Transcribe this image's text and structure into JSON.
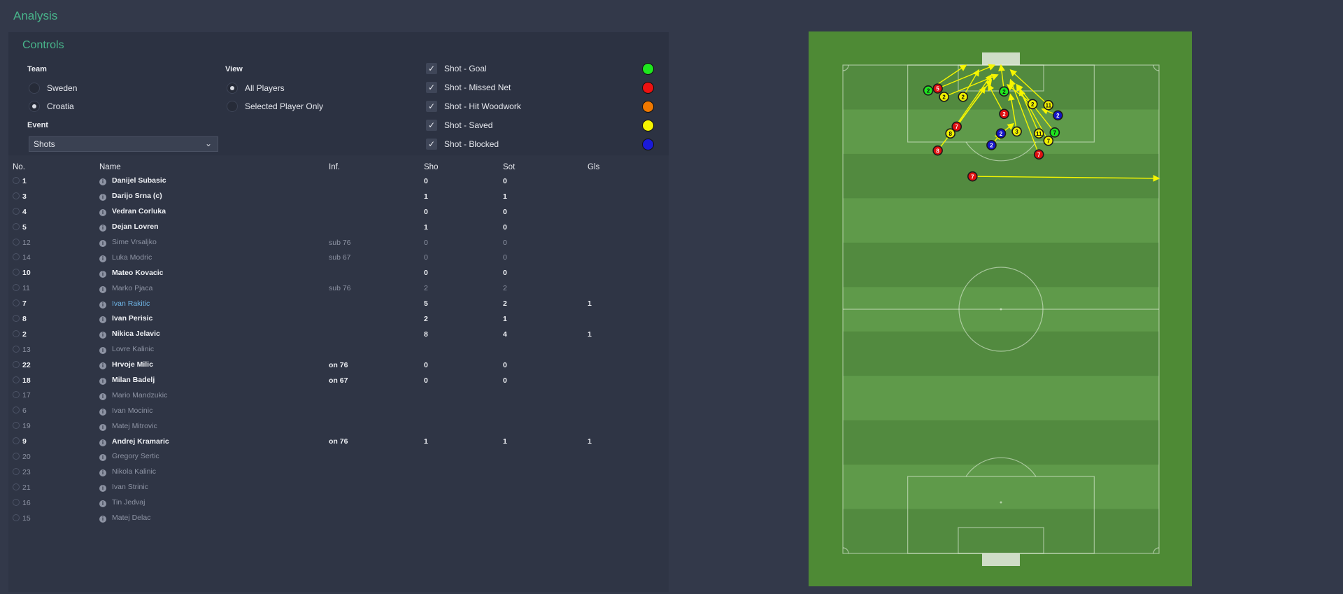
{
  "header": {
    "title": "Analysis"
  },
  "controls": {
    "title": "Controls",
    "team": {
      "label": "Team",
      "options": [
        "Sweden",
        "Croatia"
      ],
      "selected": "Croatia"
    },
    "view": {
      "label": "View",
      "options": [
        "All Players",
        "Selected Player Only"
      ],
      "selected": "All Players"
    },
    "event": {
      "label": "Event",
      "selected": "Shots"
    },
    "legend": [
      {
        "label": "Shot - Goal",
        "color": "#1ee61e",
        "checked": true
      },
      {
        "label": "Shot - Missed Net",
        "color": "#ee1111",
        "checked": true
      },
      {
        "label": "Shot - Hit Woodwork",
        "color": "#f07800",
        "checked": true
      },
      {
        "label": "Shot - Saved",
        "color": "#f5f500",
        "checked": true
      },
      {
        "label": "Shot - Blocked",
        "color": "#1a1ad8",
        "checked": true
      }
    ]
  },
  "table": {
    "columns": [
      "No.",
      "Name",
      "Inf.",
      "Sho",
      "Sot",
      "Gls"
    ],
    "rows": [
      {
        "no": "1",
        "name": "Danijel Subasic",
        "inf": "",
        "sho": "0",
        "sot": "0",
        "gls": "",
        "dim": false
      },
      {
        "no": "3",
        "name": "Darijo Srna (c)",
        "inf": "",
        "sho": "1",
        "sot": "1",
        "gls": "",
        "dim": false
      },
      {
        "no": "4",
        "name": "Vedran Corluka",
        "inf": "",
        "sho": "0",
        "sot": "0",
        "gls": "",
        "dim": false
      },
      {
        "no": "5",
        "name": "Dejan Lovren",
        "inf": "",
        "sho": "1",
        "sot": "0",
        "gls": "",
        "dim": false
      },
      {
        "no": "12",
        "name": "Sime Vrsaljko",
        "inf": "sub 76",
        "sho": "0",
        "sot": "0",
        "gls": "",
        "dim": true
      },
      {
        "no": "14",
        "name": "Luka Modric",
        "inf": "sub 67",
        "sho": "0",
        "sot": "0",
        "gls": "",
        "dim": true
      },
      {
        "no": "10",
        "name": "Mateo Kovacic",
        "inf": "",
        "sho": "0",
        "sot": "0",
        "gls": "",
        "dim": false
      },
      {
        "no": "11",
        "name": "Marko Pjaca",
        "inf": "sub 76",
        "sho": "2",
        "sot": "2",
        "gls": "",
        "dim": true
      },
      {
        "no": "7",
        "name": "Ivan Rakitic",
        "inf": "",
        "sho": "5",
        "sot": "2",
        "gls": "1",
        "dim": false,
        "selected": true
      },
      {
        "no": "8",
        "name": "Ivan Perisic",
        "inf": "",
        "sho": "2",
        "sot": "1",
        "gls": "",
        "dim": false
      },
      {
        "no": "2",
        "name": "Nikica Jelavic",
        "inf": "",
        "sho": "8",
        "sot": "4",
        "gls": "1",
        "dim": false
      },
      {
        "no": "13",
        "name": "Lovre Kalinic",
        "inf": "",
        "sho": "",
        "sot": "",
        "gls": "",
        "dim": true
      },
      {
        "no": "22",
        "name": "Hrvoje Milic",
        "inf": "on 76",
        "sho": "0",
        "sot": "0",
        "gls": "",
        "dim": false
      },
      {
        "no": "18",
        "name": "Milan Badelj",
        "inf": "on 67",
        "sho": "0",
        "sot": "0",
        "gls": "",
        "dim": false
      },
      {
        "no": "17",
        "name": "Mario Mandzukic",
        "inf": "",
        "sho": "",
        "sot": "",
        "gls": "",
        "dim": true
      },
      {
        "no": "6",
        "name": "Ivan Mocinic",
        "inf": "",
        "sho": "",
        "sot": "",
        "gls": "",
        "dim": true
      },
      {
        "no": "19",
        "name": "Matej Mitrovic",
        "inf": "",
        "sho": "",
        "sot": "",
        "gls": "",
        "dim": true
      },
      {
        "no": "9",
        "name": "Andrej Kramaric",
        "inf": "on 76",
        "sho": "1",
        "sot": "1",
        "gls": "1",
        "dim": false
      },
      {
        "no": "20",
        "name": "Gregory Sertic",
        "inf": "",
        "sho": "",
        "sot": "",
        "gls": "",
        "dim": true
      },
      {
        "no": "23",
        "name": "Nikola Kalinic",
        "inf": "",
        "sho": "",
        "sot": "",
        "gls": "",
        "dim": true
      },
      {
        "no": "21",
        "name": "Ivan Strinic",
        "inf": "",
        "sho": "",
        "sot": "",
        "gls": "",
        "dim": true
      },
      {
        "no": "16",
        "name": "Tin Jedvaj",
        "inf": "",
        "sho": "",
        "sot": "",
        "gls": "",
        "dim": true
      },
      {
        "no": "15",
        "name": "Matej Delac",
        "inf": "",
        "sho": "",
        "sot": "",
        "gls": "",
        "dim": true
      }
    ]
  },
  "pitch": {
    "colors": {
      "grass_light": "#5f9a4a",
      "grass_dark": "#528a3f",
      "border": "#4e8a35",
      "arrow": "#f5f500"
    },
    "shots": [
      {
        "player": "2",
        "outcome": "goal",
        "from": [
          0.27,
          0.052
        ],
        "to": [
          0.39,
          0.0
        ]
      },
      {
        "player": "2",
        "outcome": "saved",
        "from": [
          0.38,
          0.065
        ],
        "to": [
          0.43,
          0.01
        ]
      },
      {
        "player": "5",
        "outcome": "missed",
        "from": [
          0.3,
          0.048
        ],
        "to": [
          0.48,
          0.0
        ]
      },
      {
        "player": "2",
        "outcome": "saved",
        "from": [
          0.32,
          0.065
        ],
        "to": [
          0.49,
          0.02
        ]
      },
      {
        "player": "2",
        "outcome": "goal",
        "from": [
          0.51,
          0.054
        ],
        "to": [
          0.5,
          0.0
        ]
      },
      {
        "player": "7",
        "outcome": "missed",
        "from": [
          0.36,
          0.126
        ],
        "to": [
          0.45,
          0.045
        ]
      },
      {
        "player": "2",
        "outcome": "missed",
        "from": [
          0.51,
          0.1
        ],
        "to": [
          0.46,
          0.04
        ]
      },
      {
        "player": "2",
        "outcome": "saved",
        "from": [
          0.6,
          0.08
        ],
        "to": [
          0.52,
          0.04
        ]
      },
      {
        "player": "11",
        "outcome": "saved",
        "from": [
          0.65,
          0.082
        ],
        "to": [
          0.53,
          0.01
        ]
      },
      {
        "player": "2",
        "outcome": "blocked",
        "from": [
          0.68,
          0.103
        ],
        "to": [
          0.63,
          0.09
        ]
      },
      {
        "player": "8",
        "outcome": "saved",
        "from": [
          0.34,
          0.14
        ],
        "to": [
          0.47,
          0.02
        ]
      },
      {
        "player": "2",
        "outcome": "blocked",
        "from": [
          0.5,
          0.14
        ],
        "to": [
          0.54,
          0.12
        ]
      },
      {
        "player": "3",
        "outcome": "saved",
        "from": [
          0.55,
          0.136
        ],
        "to": [
          0.53,
          0.06
        ]
      },
      {
        "player": "11",
        "outcome": "saved",
        "from": [
          0.62,
          0.14
        ],
        "to": [
          0.56,
          0.05
        ]
      },
      {
        "player": "7",
        "outcome": "goal",
        "from": [
          0.67,
          0.138
        ],
        "to": [
          0.55,
          0.04
        ]
      },
      {
        "player": "7",
        "outcome": "saved",
        "from": [
          0.65,
          0.155
        ],
        "to": [
          0.55,
          0.04
        ]
      },
      {
        "player": "2",
        "outcome": "blocked",
        "from": [
          0.47,
          0.164
        ],
        "to": [
          0.5,
          0.14
        ]
      },
      {
        "player": "8",
        "outcome": "missed",
        "from": [
          0.3,
          0.175
        ],
        "to": [
          0.47,
          0.03
        ]
      },
      {
        "player": "7",
        "outcome": "missed",
        "from": [
          0.62,
          0.183
        ],
        "to": [
          0.53,
          0.03
        ]
      },
      {
        "player": "7",
        "outcome": "missed",
        "from": [
          0.41,
          0.228
        ],
        "to": [
          1.0,
          0.232
        ]
      }
    ]
  }
}
